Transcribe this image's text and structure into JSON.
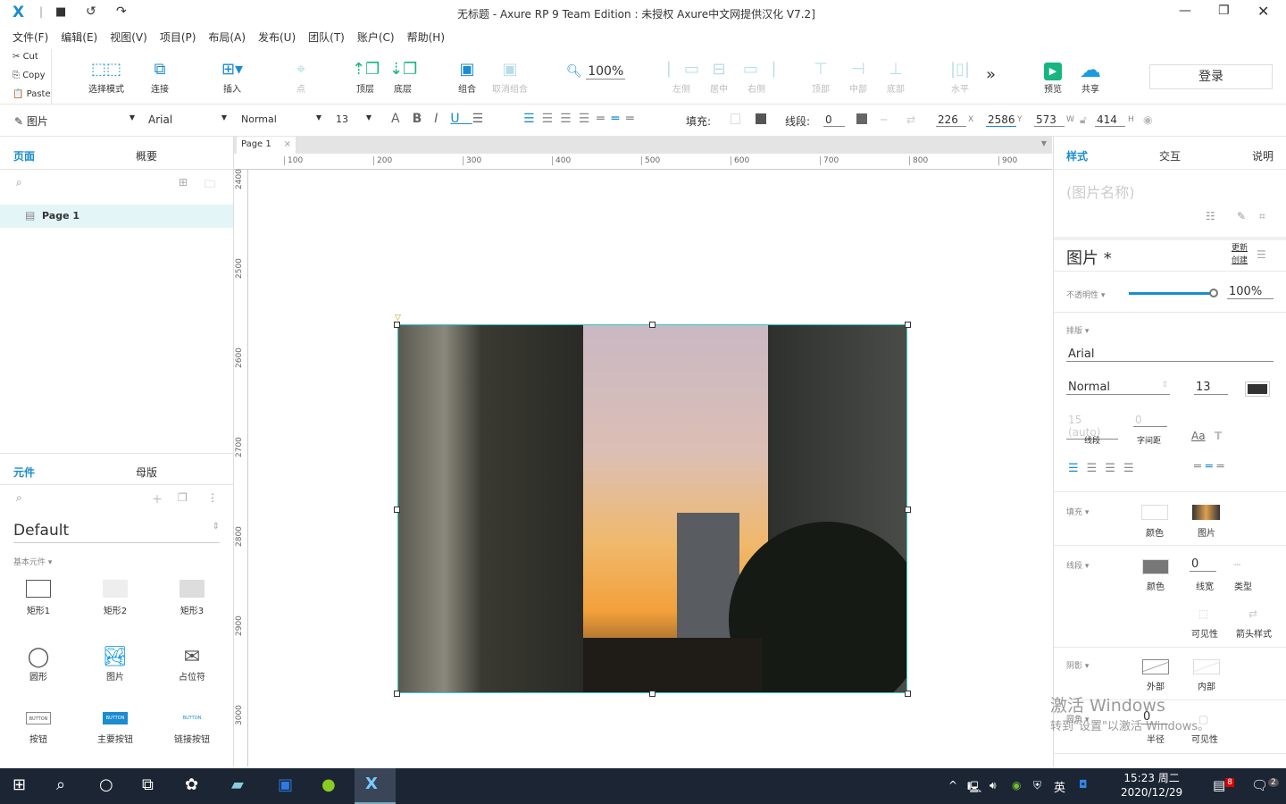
{
  "title": "无标题 - Axure RP 9 Team Edition : 未授权    Axure中文网提供汉化 V7.2]",
  "menu": [
    "文件(F)",
    "编辑(E)",
    "视图(V)",
    "项目(P)",
    "布局(A)",
    "发布(U)",
    "团队(T)",
    "账户(C)",
    "帮助(H)"
  ],
  "clipboard": {
    "cut": "Cut",
    "copy": "Copy",
    "paste": "Paste"
  },
  "toolbar": {
    "select_mode": "选择模式",
    "connect": "连接",
    "insert": "插入",
    "point": "点",
    "top": "顶层",
    "bottom": "底层",
    "group": "组合",
    "ungroup": "取消组合",
    "zoom": "100%",
    "align_left": "左侧",
    "align_center": "居中",
    "align_right": "右侧",
    "align_top": "顶部",
    "align_middle": "中部",
    "align_bottom": "底部",
    "distribute": "水平",
    "preview": "预览",
    "share": "共享",
    "login": "登录"
  },
  "format": {
    "style": "图片",
    "font": "Arial",
    "weight": "Normal",
    "size": "13",
    "fill_label": "填充:",
    "stroke_label": "线段:",
    "stroke": "0",
    "x": "226",
    "x_label": "X",
    "y": "2586",
    "y_label": "Y",
    "w": "573",
    "w_label": "W",
    "h": "414",
    "h_label": "H"
  },
  "pages": {
    "tab_pages": "页面",
    "tab_outline": "概要",
    "items": [
      "Page 1"
    ]
  },
  "library": {
    "tab_widgets": "元件",
    "tab_masters": "母版",
    "selected": "Default",
    "group": "基本元件 ▾",
    "widgets": [
      "矩形1",
      "矩形2",
      "矩形3",
      "圆形",
      "图片",
      "占位符",
      "按钮",
      "主要按钮",
      "链接按钮"
    ],
    "button_text": "BUTTON"
  },
  "canvas": {
    "tab": "Page 1",
    "ruler_x": [
      "100",
      "200",
      "300",
      "400",
      "500",
      "600",
      "700",
      "800",
      "900"
    ],
    "ruler_y": [
      "2400",
      "2500",
      "2600",
      "2700",
      "2800",
      "2900",
      "3000"
    ]
  },
  "inspector": {
    "tabs": [
      "样式",
      "交互",
      "说明"
    ],
    "name_placeholder": "(图片名称)",
    "style_name": "图片 *",
    "update": "更新",
    "create": "创建",
    "opacity_label": "不透明性 ▾",
    "opacity": "100%",
    "opacity_value": 1.0,
    "typography_label": "排版 ▾",
    "font": "Arial",
    "weight": "Normal",
    "size": "13",
    "line_height": "15 (auto)",
    "line_label": "线段",
    "spacing": "0",
    "spacing_label": "字间距",
    "fill_label": "填充 ▾",
    "color": "颜色",
    "image": "图片",
    "stroke_label": "线段 ▾",
    "stroke_width": "0",
    "stroke_width_label": "线宽",
    "type": "类型",
    "visibility": "可见性",
    "arrow": "箭头样式",
    "shadow_label": "阴影 ▾",
    "outer": "外部",
    "inner": "内部",
    "corner_label": "圆角 ▾",
    "radius": "0",
    "radius_label": "半径",
    "corner_vis": "可见性"
  },
  "watermark": {
    "line1": "激活 Windows",
    "line2": "转到\"设置\"以激活 Windows。"
  },
  "taskbar": {
    "ime": "英",
    "time": "15:23 周二",
    "date": "2020/12/29",
    "badge1": "8",
    "badge2": "2"
  },
  "colors": {
    "accent": "#1a8ccf",
    "taskbar": "#1b2534",
    "preview": "#17b580"
  }
}
